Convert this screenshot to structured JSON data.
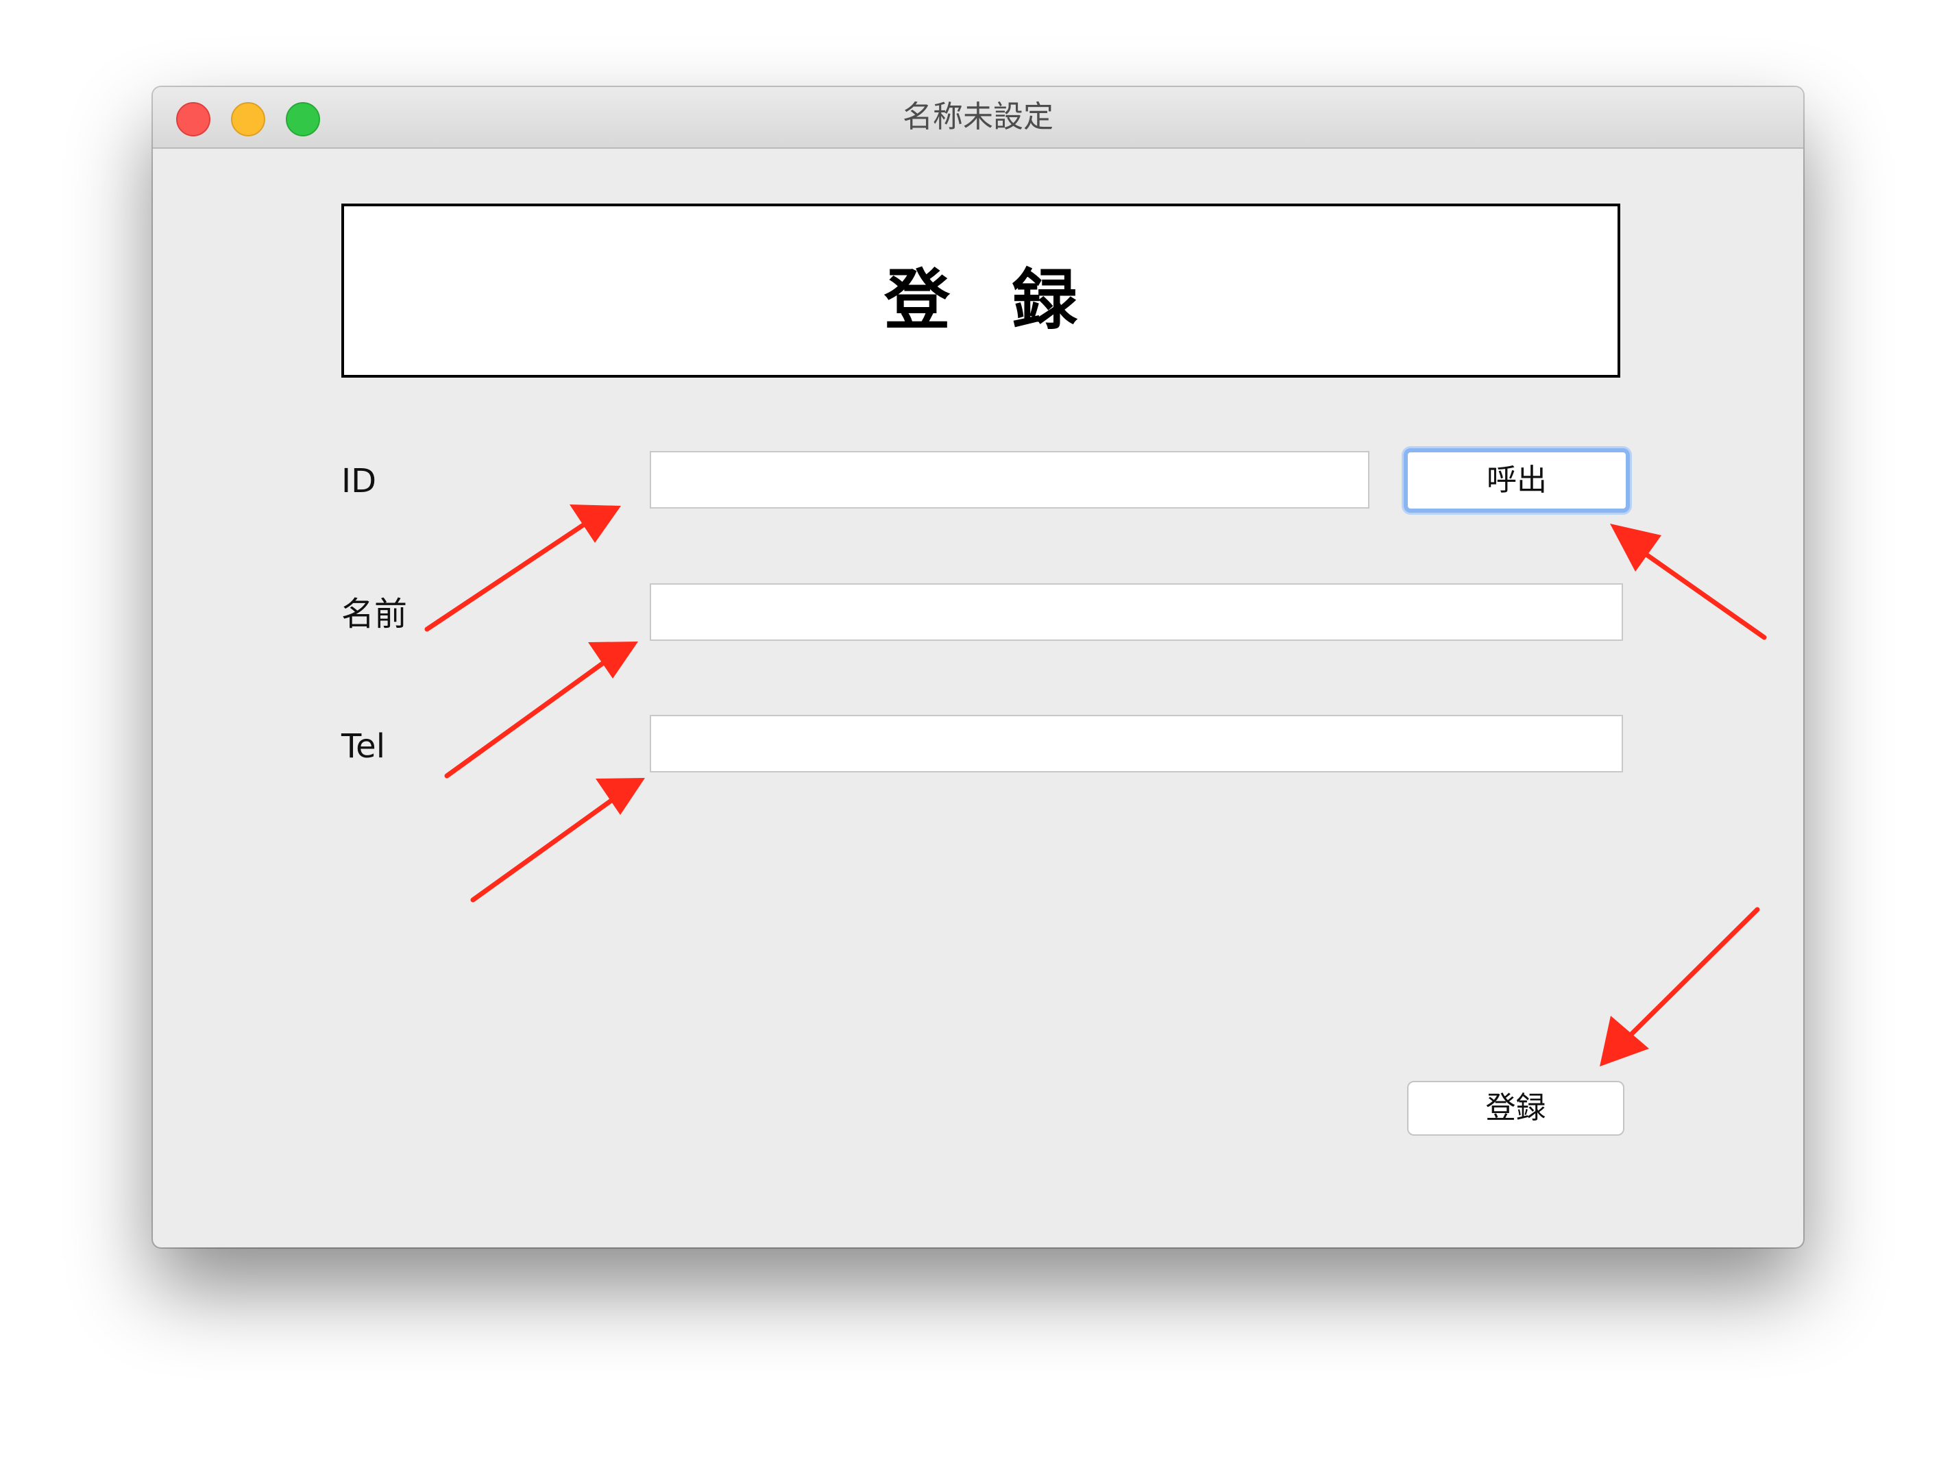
{
  "window": {
    "title": "名称未設定"
  },
  "form": {
    "heading": "登録",
    "id_label": "ID",
    "name_label": "名前",
    "tel_label": "Tel",
    "id_value": "",
    "name_value": "",
    "tel_value": "",
    "call_button": "呼出",
    "register_button": "登録"
  },
  "colors": {
    "arrow": "#ff2a1a",
    "window_bg": "#ececec",
    "focus_ring": "#8ab5f3"
  }
}
